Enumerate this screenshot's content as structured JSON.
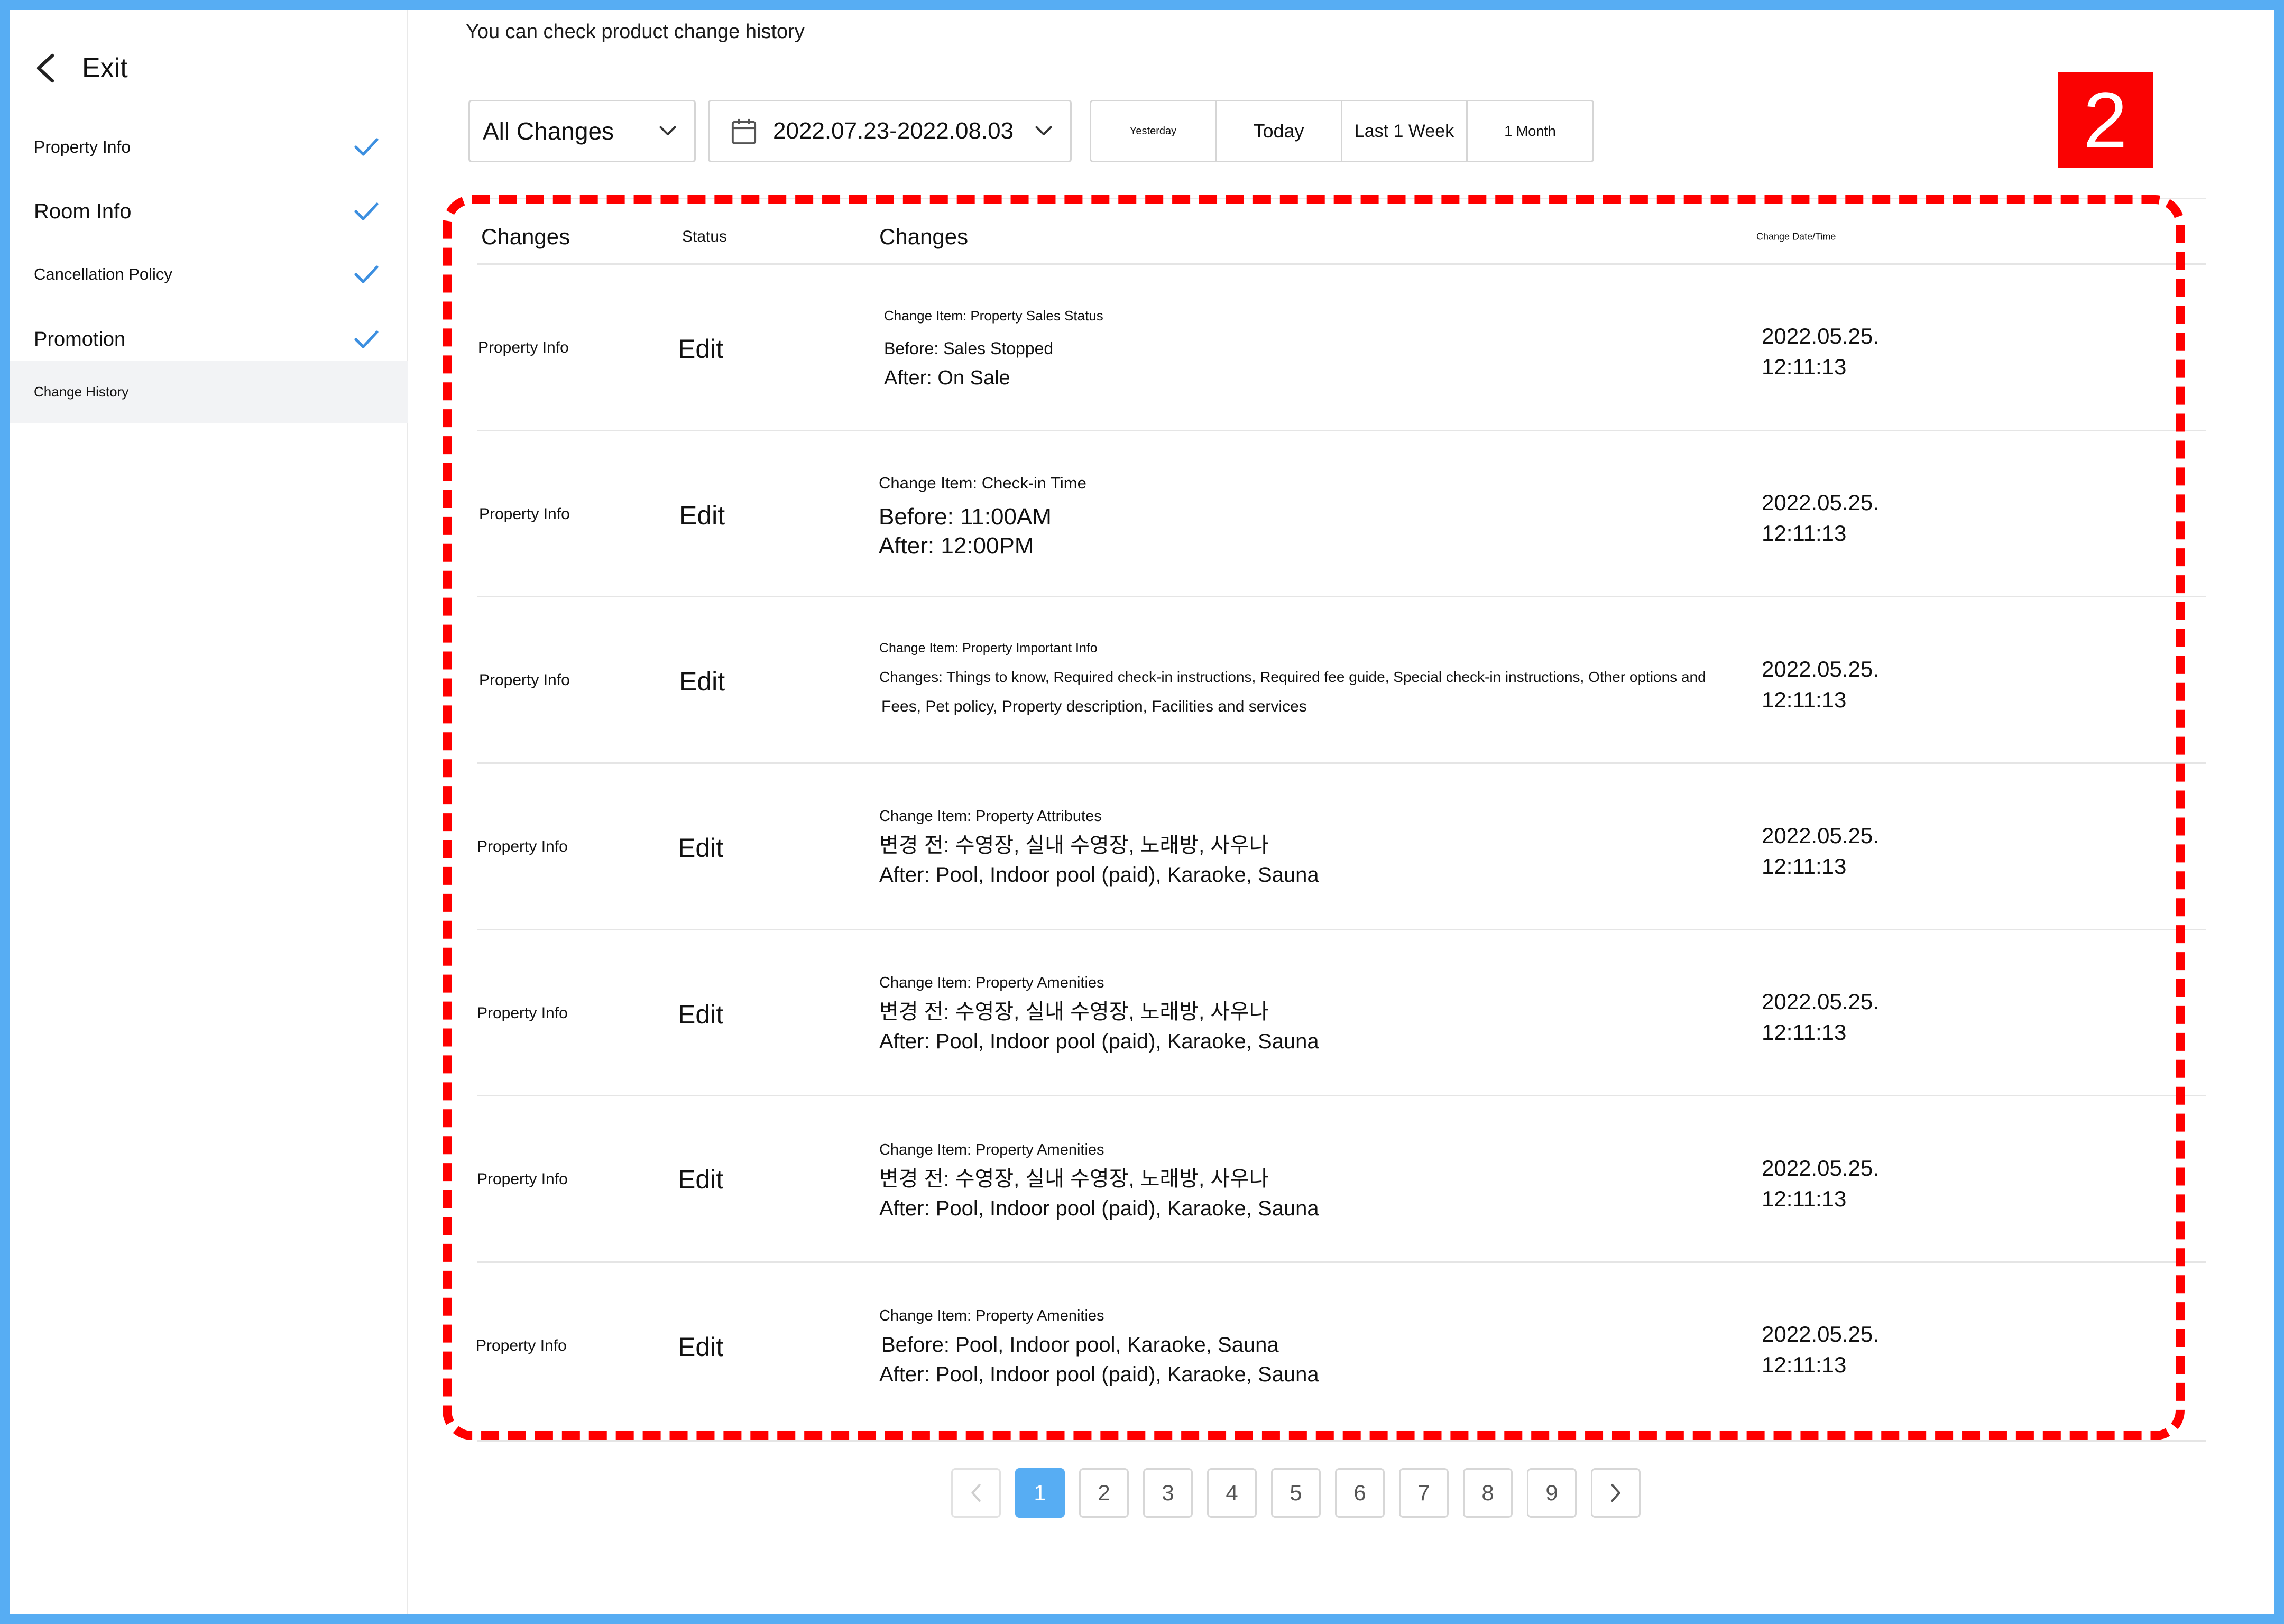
{
  "colors": {
    "accent": "#57adf3",
    "annotation_red": "#ff0000",
    "badge_red": "#fa0202"
  },
  "sidebar": {
    "exit_label": "Exit",
    "items": [
      {
        "label": "Property Info",
        "checked": true,
        "active": false
      },
      {
        "label": "Room Info",
        "checked": true,
        "active": false
      },
      {
        "label": "Cancellation Policy",
        "checked": true,
        "active": false
      },
      {
        "label": "Promotion",
        "checked": true,
        "active": false
      },
      {
        "label": "Change History",
        "checked": false,
        "active": true
      }
    ]
  },
  "header": {
    "subtitle": "You can check product change history"
  },
  "filters": {
    "change_type": "All Changes",
    "date_range": "2022.07.23-2022.08.03",
    "quick_ranges": [
      "Yesterday",
      "Today",
      "Last 1 Week",
      "1 Month"
    ]
  },
  "annotation": {
    "badge_number": "2"
  },
  "table": {
    "headers": {
      "type": "Changes",
      "status": "Status",
      "changes": "Changes",
      "date": "Change Date/Time"
    },
    "rows": [
      {
        "type": "Property Info",
        "status": "Edit",
        "item": "Change Item: Property Sales Status",
        "lines": [
          "Before: Sales Stopped",
          "After: On Sale"
        ],
        "date": "2022.05.25.",
        "time": "12:11:13"
      },
      {
        "type": "Property Info",
        "status": "Edit",
        "item": "Change Item: Check-in Time",
        "lines": [
          "Before: 11:00AM",
          "After: 12:00PM"
        ],
        "date": "2022.05.25.",
        "time": "12:11:13"
      },
      {
        "type": "Property Info",
        "status": "Edit",
        "item": "Change Item: Property Important Info",
        "lines": [
          "Changes: Things to know, Required check-in instructions, Required fee guide, Special check-in instructions, Other options and",
          "Fees, Pet policy, Property description, Facilities and services"
        ],
        "date": "2022.05.25.",
        "time": "12:11:13"
      },
      {
        "type": "Property Info",
        "status": "Edit",
        "item": "Change Item: Property Attributes",
        "lines": [
          "변경 전: 수영장, 실내 수영장, 노래방, 사우나",
          "After: Pool, Indoor pool (paid), Karaoke, Sauna"
        ],
        "date": "2022.05.25.",
        "time": "12:11:13"
      },
      {
        "type": "Property Info",
        "status": "Edit",
        "item": "Change Item: Property Amenities",
        "lines": [
          "변경 전: 수영장, 실내 수영장, 노래방, 사우나",
          "After: Pool, Indoor pool (paid), Karaoke, Sauna"
        ],
        "date": "2022.05.25.",
        "time": "12:11:13"
      },
      {
        "type": "Property Info",
        "status": "Edit",
        "item": "Change Item: Property Amenities",
        "lines": [
          "변경 전: 수영장, 실내 수영장, 노래방, 사우나",
          "After: Pool, Indoor pool (paid), Karaoke, Sauna"
        ],
        "date": "2022.05.25.",
        "time": "12:11:13"
      },
      {
        "type": "Property Info",
        "status": "Edit",
        "item": "Change Item: Property Amenities",
        "lines": [
          "Before: Pool, Indoor pool, Karaoke, Sauna",
          "After: Pool, Indoor pool (paid), Karaoke, Sauna"
        ],
        "date": "2022.05.25.",
        "time": "12:11:13"
      }
    ]
  },
  "pagination": {
    "pages": [
      "1",
      "2",
      "3",
      "4",
      "5",
      "6",
      "7",
      "8",
      "9"
    ],
    "current": "1"
  }
}
